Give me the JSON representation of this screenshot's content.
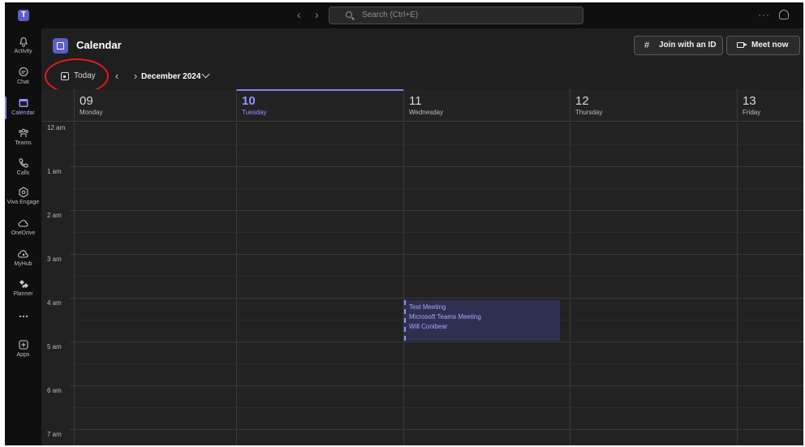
{
  "titlebar": {
    "search_placeholder": "Search (Ctrl+E)",
    "more": "···"
  },
  "rail": [
    {
      "label": "Activity",
      "icon": "bell-icon"
    },
    {
      "label": "Chat",
      "icon": "chat-icon"
    },
    {
      "label": "Calendar",
      "icon": "calendar-icon",
      "active": true
    },
    {
      "label": "Teams",
      "icon": "teams-icon"
    },
    {
      "label": "Calls",
      "icon": "phone-icon"
    },
    {
      "label": "Viva Engage",
      "icon": "viva-engage-icon"
    },
    {
      "label": "OneDrive",
      "icon": "cloud-icon"
    },
    {
      "label": "MyHub",
      "icon": "myhub-icon"
    },
    {
      "label": "Planner",
      "icon": "planner-icon"
    },
    {
      "label": "",
      "icon": "more-apps-icon"
    },
    {
      "label": "Apps",
      "icon": "add-apps-icon"
    }
  ],
  "header": {
    "title": "Calendar",
    "join_label": "Join with an ID",
    "meet_label": "Meet now"
  },
  "toolbar": {
    "today_label": "Today",
    "month_label": "December 2024"
  },
  "days": [
    {
      "num": "09",
      "name": "Monday",
      "today": false
    },
    {
      "num": "10",
      "name": "Tuesday",
      "today": true
    },
    {
      "num": "11",
      "name": "Wednesday",
      "today": false
    },
    {
      "num": "12",
      "name": "Thursday",
      "today": false
    },
    {
      "num": "13",
      "name": "Friday",
      "today": false
    }
  ],
  "times": [
    "12 am",
    "1 am",
    "2 am",
    "3 am",
    "4 am",
    "5 am",
    "6 am",
    "7 am"
  ],
  "event": {
    "title": "Test Meeting",
    "location": "Microsoft Teams Meeting",
    "organizer": "Will Conibear"
  },
  "colors": {
    "accent": "#7f85f5",
    "annotation": "#e31b1b"
  }
}
